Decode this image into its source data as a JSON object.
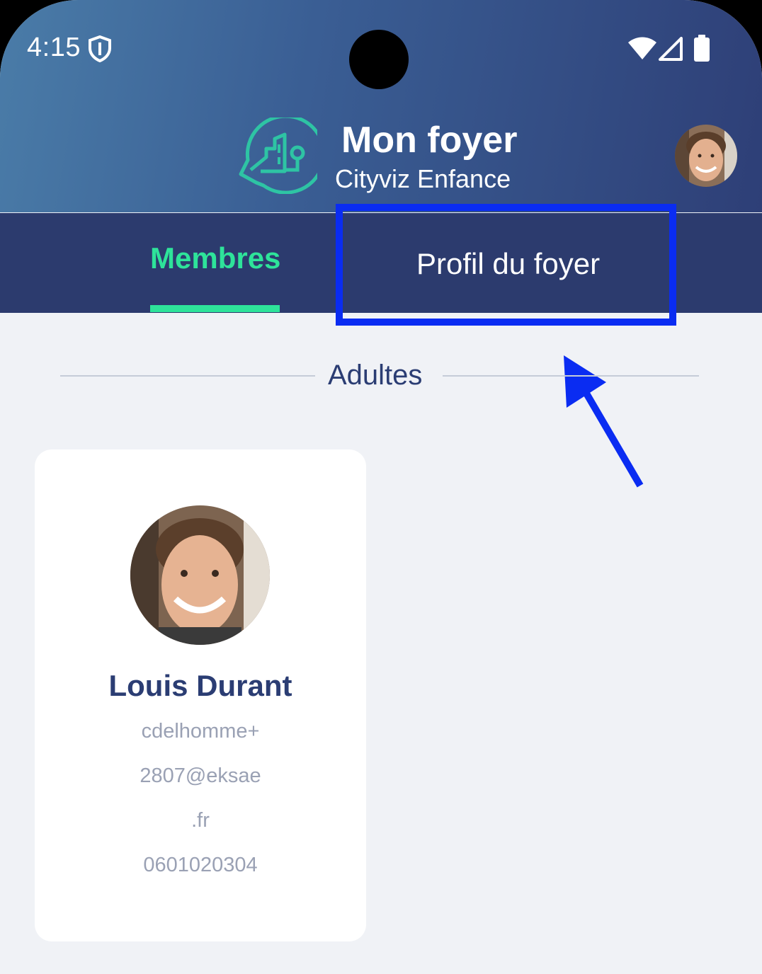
{
  "status_bar": {
    "time": "4:15",
    "icons": [
      "shield-icon",
      "wifi-icon",
      "signal-icon",
      "battery-icon"
    ]
  },
  "header": {
    "title": "Mon foyer",
    "subtitle": "Cityviz Enfance",
    "logo_icon": "cityviz-logo-icon",
    "avatar_icon": "user-avatar"
  },
  "tabs": [
    {
      "label": "Membres",
      "active": true
    },
    {
      "label": "Profil du foyer",
      "active": false
    }
  ],
  "section": {
    "title": "Adultes"
  },
  "members": [
    {
      "name": "Louis Durant",
      "email_line1": "cdelhomme+",
      "email_line2": "2807@eksae",
      "email_line3": ".fr",
      "phone": "0601020304"
    }
  ],
  "colors": {
    "header_start": "#4a7ca8",
    "header_end": "#2e3f77",
    "tab_bar": "#2c3b6e",
    "accent_green": "#2ee39a",
    "annotation_blue": "#0a2cf2",
    "text_dark": "#2b3d73",
    "text_muted": "#9aa1b4"
  }
}
